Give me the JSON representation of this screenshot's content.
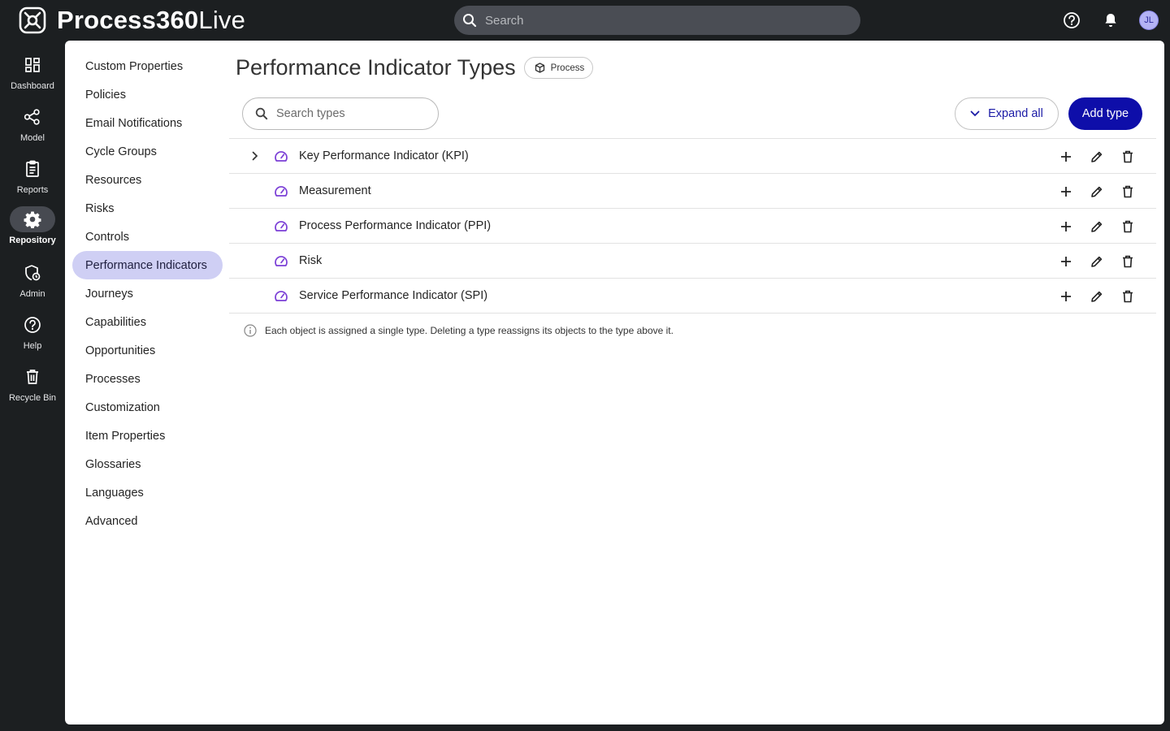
{
  "app": {
    "logo_bold": "Process360",
    "logo_light": "Live",
    "search_placeholder": "Search",
    "user_initials": "JL"
  },
  "rail": [
    {
      "label": "Dashboard",
      "icon": "dashboard-icon",
      "active": false
    },
    {
      "label": "Model",
      "icon": "model-icon",
      "active": false
    },
    {
      "label": "Reports",
      "icon": "reports-icon",
      "active": false
    },
    {
      "label": "Repository",
      "icon": "gear-icon",
      "active": true
    },
    {
      "label": "Admin",
      "icon": "admin-shield-icon",
      "active": false
    },
    {
      "label": "Help",
      "icon": "help-icon",
      "active": false
    },
    {
      "label": "Recycle Bin",
      "icon": "trash-icon",
      "active": false
    }
  ],
  "subnav": [
    "Custom Properties",
    "Policies",
    "Email Notifications",
    "Cycle Groups",
    "Resources",
    "Risks",
    "Controls",
    "Performance Indicators",
    "Journeys",
    "Capabilities",
    "Opportunities",
    "Processes",
    "Customization",
    "Item Properties",
    "Glossaries",
    "Languages",
    "Advanced"
  ],
  "subnav_active": "Performance Indicators",
  "page": {
    "title": "Performance Indicator Types",
    "chip_label": "Process",
    "type_search_placeholder": "Search types",
    "expand_all_label": "Expand all",
    "add_type_label": "Add type",
    "info_text": "Each object is assigned a single type. Deleting a type reassigns its objects to the type above it."
  },
  "types": [
    {
      "label": "Key Performance Indicator (KPI)",
      "expandable": true
    },
    {
      "label": "Measurement",
      "expandable": false
    },
    {
      "label": "Process Performance Indicator (PPI)",
      "expandable": false
    },
    {
      "label": "Risk",
      "expandable": false
    },
    {
      "label": "Service Performance Indicator (SPI)",
      "expandable": false
    }
  ],
  "colors": {
    "accent": "#0e0ea9",
    "type_icon": "#7b3fd6",
    "active_nav": "#cfcff4",
    "shell": "#1c1f21"
  }
}
